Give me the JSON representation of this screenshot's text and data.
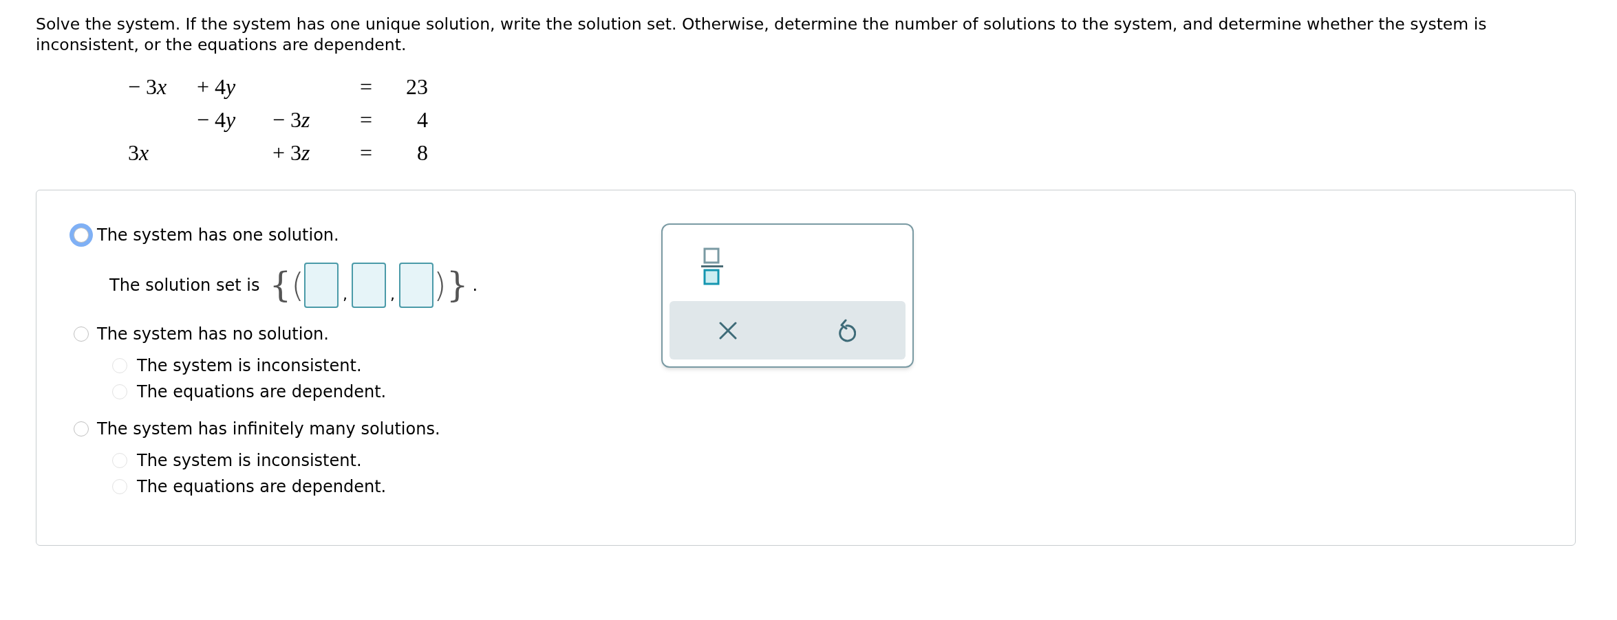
{
  "prompt": "Solve the system. If the system has one unique solution, write the solution set. Otherwise, determine the number of solutions to the system, and determine whether the system is inconsistent, or the equations are dependent.",
  "equations": [
    {
      "x_term": {
        "coefficient": "− 3",
        "variable": "x"
      },
      "y_term": {
        "coefficient": "+ 4",
        "variable": "y"
      },
      "relation": "=",
      "rhs": "23"
    },
    {
      "y_term": {
        "coefficient": "− 4",
        "variable": "y"
      },
      "z_term": {
        "coefficient": "− 3",
        "variable": "z"
      },
      "relation": "=",
      "rhs": "4"
    },
    {
      "x_term": {
        "coefficient": "3",
        "variable": "x"
      },
      "z_term": {
        "coefficient": "+ 3",
        "variable": "z"
      },
      "relation": "=",
      "rhs": "8"
    }
  ],
  "options": [
    {
      "label": "The system has one solution.",
      "selected": false,
      "focused": true,
      "solution_set": {
        "label": "The solution set is",
        "open_brace": "{",
        "open_paren": "(",
        "fields": [
          {
            "focused": false
          },
          {
            "focused": false
          },
          {
            "focused": false
          }
        ],
        "separators": [
          ",",
          ","
        ],
        "close_paren": ")",
        "close_brace": "}",
        "end": "."
      }
    },
    {
      "label": "The system has no solution.",
      "selected": false,
      "focused": false,
      "sub_options": [
        {
          "label": "The system is inconsistent.",
          "selected": false
        },
        {
          "label": "The equations are dependent.",
          "selected": false
        }
      ]
    },
    {
      "label": "The system has infinitely many solutions.",
      "selected": false,
      "focused": false,
      "sub_options": [
        {
          "label": "The system is inconsistent.",
          "selected": false
        },
        {
          "label": "The equations are dependent.",
          "selected": false
        }
      ]
    }
  ],
  "palette": {
    "tools": [
      {
        "kind": "fraction"
      }
    ],
    "actions": [
      {
        "kind": "clear"
      },
      {
        "kind": "undo"
      }
    ]
  }
}
